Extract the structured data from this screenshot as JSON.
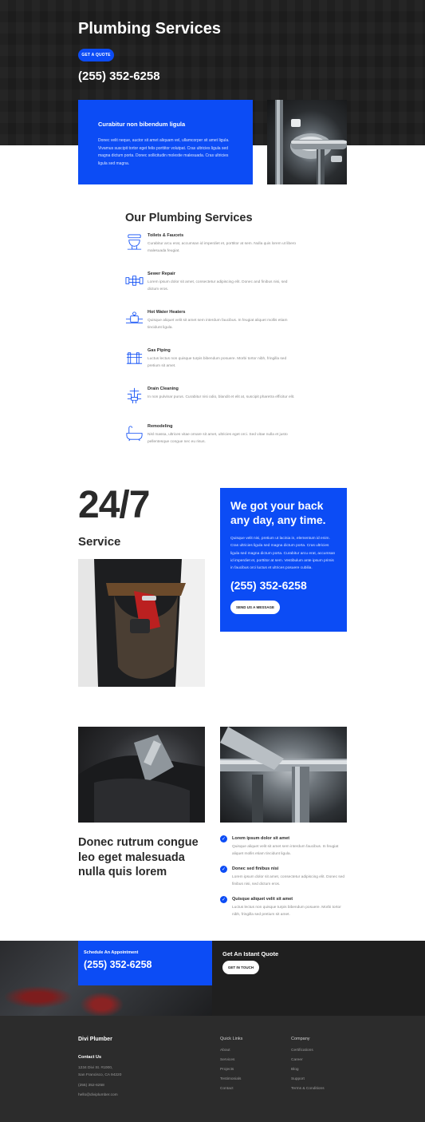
{
  "hero": {
    "title": "Plumbing Services",
    "quote_button": "GET A QUOTE",
    "phone": "(255) 352-6258"
  },
  "intro_card": {
    "title": "Curabitur non bibendum ligula",
    "body": "Donec velit neque, auctor sit amet aliquam vel, ullamcorper sit amet ligula. Vivamus suscipit tortor eget felis porttitor volutpat. Cras ultricies ligula sed magna dictum porta. Donec sollicitudin molestie malesuada. Cras ultricies ligula sed magna."
  },
  "services": {
    "title": "Our Plumbing Services",
    "items": [
      {
        "name": "Toilets & Faucets",
        "icon": "toilet-icon",
        "desc": "Curabitur arcu erat, accumsan id imperdiet et, porttitor at sem. Nulla quis lorem ut libero malesuada feugiat."
      },
      {
        "name": "Sewer Repair",
        "icon": "sewer-pipe-icon",
        "desc": "Lorem ipsum dolor sit amet, consectetur adipiscing elit. Donec and finibus nisi, sed dictum eros."
      },
      {
        "name": "Hot Water Heaters",
        "icon": "water-heater-icon",
        "desc": "Quisque aliquet velit sit amet sem interdum faucibus. In feugiat aliquet mollis etiam tincidunt ligula."
      },
      {
        "name": "Gas Piping",
        "icon": "gas-pipe-icon",
        "desc": "Luctus lectus non quisque turpis bibendum posuere. Morbi tortor nibh, fringilla sed pretium sit amet."
      },
      {
        "name": "Drain Cleaning",
        "icon": "drain-icon",
        "desc": "In non pulvinar purus. Curabitur nisi odio, blandit et elit at, suscipit pharetra efficitur elit."
      },
      {
        "name": "Remodeling",
        "icon": "bathtub-icon",
        "desc": "Nisl massa, ultrices vitae ornare sit amet, ultricies eget orci. Sed vitae nulla et justo pellentesque congue nec eu risus."
      }
    ]
  },
  "availability": {
    "big": "24/7",
    "label": "Service",
    "card_title": "We got your back any day, any time.",
    "card_body": "Quisque velit nisi, pretium ut lacinia in, elementum id enim. Cras ultricies ligula sed magna dictum porta. Cras ultricies ligula sed magna dictum porta. Curabitur arcu erat, accumsan id imperdiet et, porttitor at sem. Vestibulum ante ipsum primis in faucibus orci luctus et ultrices posuere cubilia.",
    "card_phone": "(255) 352-6258",
    "message_button": "SEND US A MESSAGE"
  },
  "features": {
    "heading": "Donec rutrum congue leo eget malesuada nulla quis lorem",
    "items": [
      {
        "name": "Lorem ipsum dolor sit amet",
        "desc": "Quisque aliquet velit sit amet sem interdum faucibus. In feugiat aliquet mollis etiam tincidunt ligula."
      },
      {
        "name": "Donec sed finibus nisi",
        "desc": "Lorem ipsum dolor sit amet, consectetur adipiscing elit. Donec sed finibus nisi, sed dictum eros."
      },
      {
        "name": "Quisque aliquet velit sit amet",
        "desc": "Luctus lectus non quisque turpis bibendum posuere. Morbi tortor nibh, fringilla sed pretium sit amet."
      }
    ]
  },
  "cta": {
    "appointment_label": "Schedule An Appointment",
    "appointment_phone": "(255) 352-6258",
    "quote_label": "Get An Istant Quote",
    "touch_button": "GET IN TOUCH"
  },
  "footer": {
    "brand": "Divi Plumber",
    "contact_title": "Contact Us",
    "address_1": "1234 Divi St. #1000,",
    "address_2": "San Francisco, CA 94220",
    "phone": "(255) 352-6258",
    "email": "hello@diviplumber.com",
    "quick_links_title": "Quick Links",
    "quick_links": [
      "About",
      "Services",
      "Projects",
      "Testimonials",
      "Contact"
    ],
    "company_title": "Company",
    "company_links": [
      "Certifications",
      "Career",
      "Blog",
      "Support",
      "Terms & Conditions"
    ]
  },
  "colors": {
    "accent": "#0c4cf5",
    "dark": "#1c1c1c",
    "footer": "#2c2c2c"
  }
}
